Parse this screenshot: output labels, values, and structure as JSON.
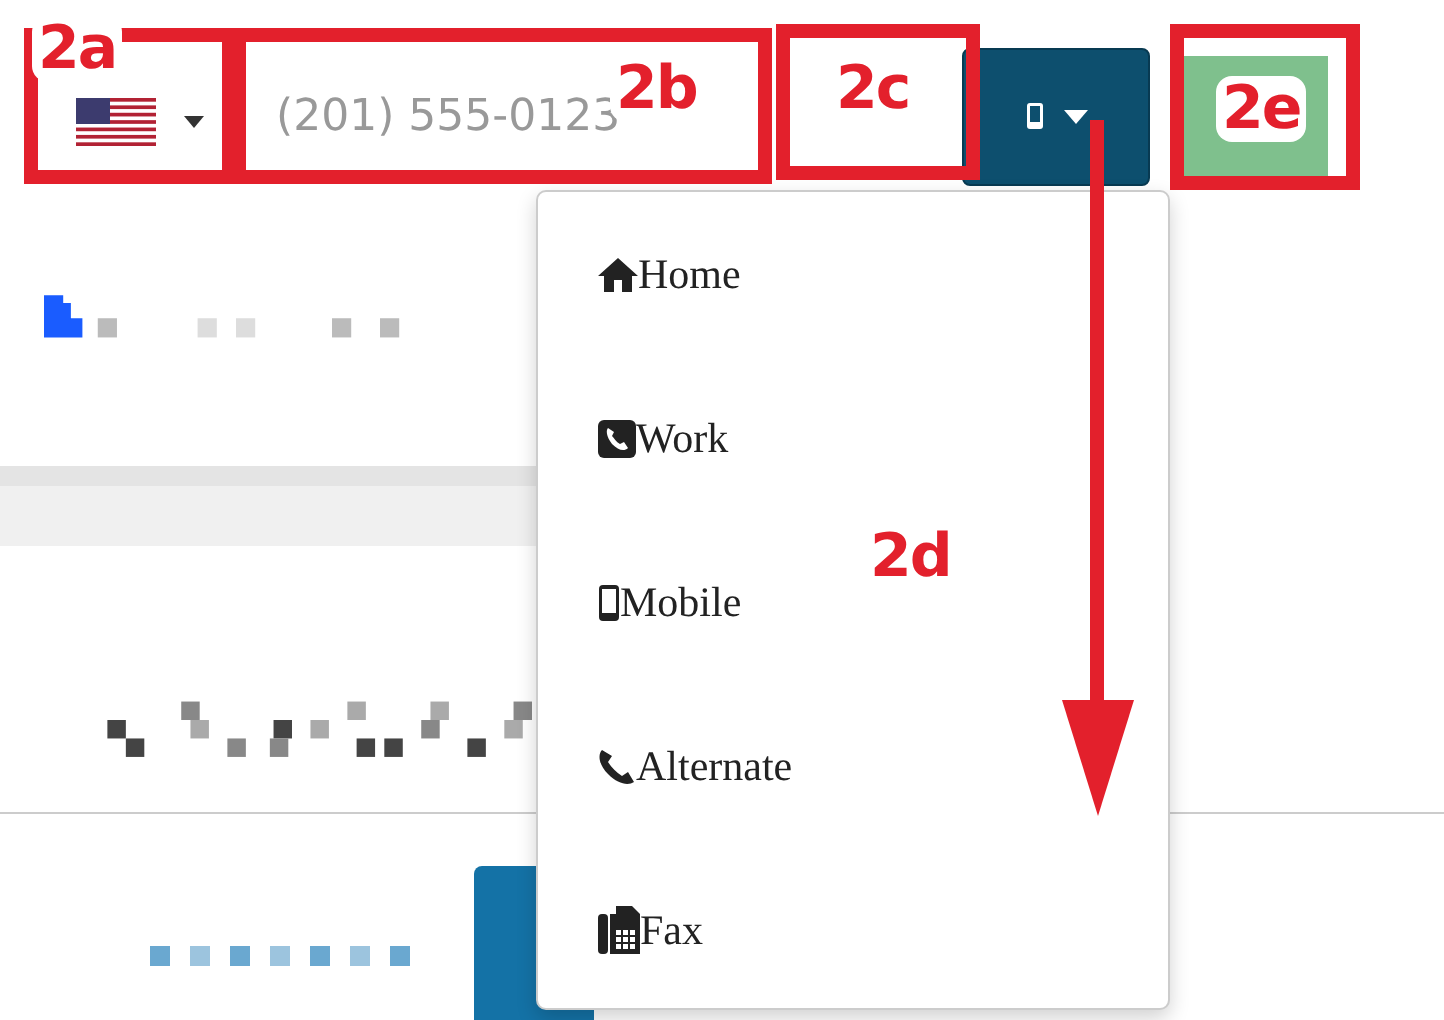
{
  "phone_form": {
    "phone": {
      "placeholder": "(201) 555-0123"
    },
    "type_menu": {
      "expanded": true,
      "items": [
        {
          "label": "Home",
          "kind": "home"
        },
        {
          "label": "Work",
          "kind": "work"
        },
        {
          "label": "Mobile",
          "kind": "mobile"
        },
        {
          "label": "Alternate",
          "kind": "alternate"
        },
        {
          "label": "Fax",
          "kind": "fax"
        }
      ]
    }
  },
  "annotations": [
    {
      "label": "2a"
    },
    {
      "label": "2b"
    },
    {
      "label": "2c"
    },
    {
      "label": "2d"
    },
    {
      "label": "2e"
    }
  ]
}
